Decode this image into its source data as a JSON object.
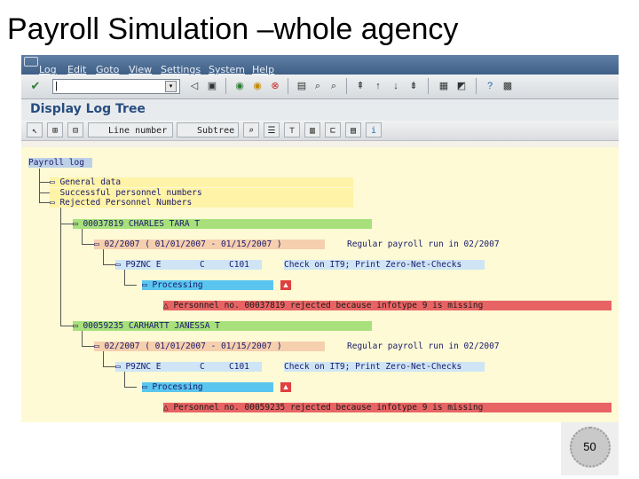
{
  "slide": {
    "title": "Payroll Simulation –whole agency",
    "page_number": "50"
  },
  "menu": {
    "items": [
      "Log",
      "Edit",
      "Goto",
      "View",
      "Settings",
      "System",
      "Help"
    ]
  },
  "toolbar": {
    "command_value": "|",
    "icons": [
      "enter-icon",
      "cmd-dropdown-icon",
      "back-arrow-icon",
      "save-icon",
      "back-icon",
      "exit-icon",
      "cancel-icon",
      "print-icon",
      "find-icon",
      "find-next-icon",
      "first-page-icon",
      "prev-page-icon",
      "next-page-icon",
      "last-page-icon",
      "create-session-icon",
      "shortcut-icon",
      "help-icon",
      "layout-icon"
    ]
  },
  "screen": {
    "title": "Display Log Tree"
  },
  "app_toolbar": {
    "line_number_label": "Line number",
    "subtree_label": "Subtree"
  },
  "tree": {
    "root": "Payroll log",
    "general_data": "General data",
    "successful": "Successful personnel numbers",
    "rejected": "Rejected Personnel Numbers",
    "employees": [
      {
        "id_name": "00037819 CHARLES TARA T",
        "period": "02/2007 ( 01/01/2007 - 01/15/2007 )",
        "run": "Regular payroll run in 02/2007",
        "func": "P9ZNC E",
        "func_c": "C",
        "func_code": "C101",
        "func_desc": "Check on IT9; Print Zero-Net-Checks",
        "processing": "Processing",
        "message": "Personnel no. 00037819 rejected because infotype 9 is missing"
      },
      {
        "id_name": "00059235 CARHARTT JANESSA T",
        "period": "02/2007 ( 01/01/2007 - 01/15/2007 )",
        "run": "Regular payroll run in 02/2007",
        "func": "P9ZNC E",
        "func_c": "C",
        "func_code": "C101",
        "func_desc": "Check on IT9; Print Zero-Net-Checks",
        "processing": "Processing",
        "message": "Personnel no. 00059235 rejected because infotype 9 is missing"
      }
    ]
  }
}
